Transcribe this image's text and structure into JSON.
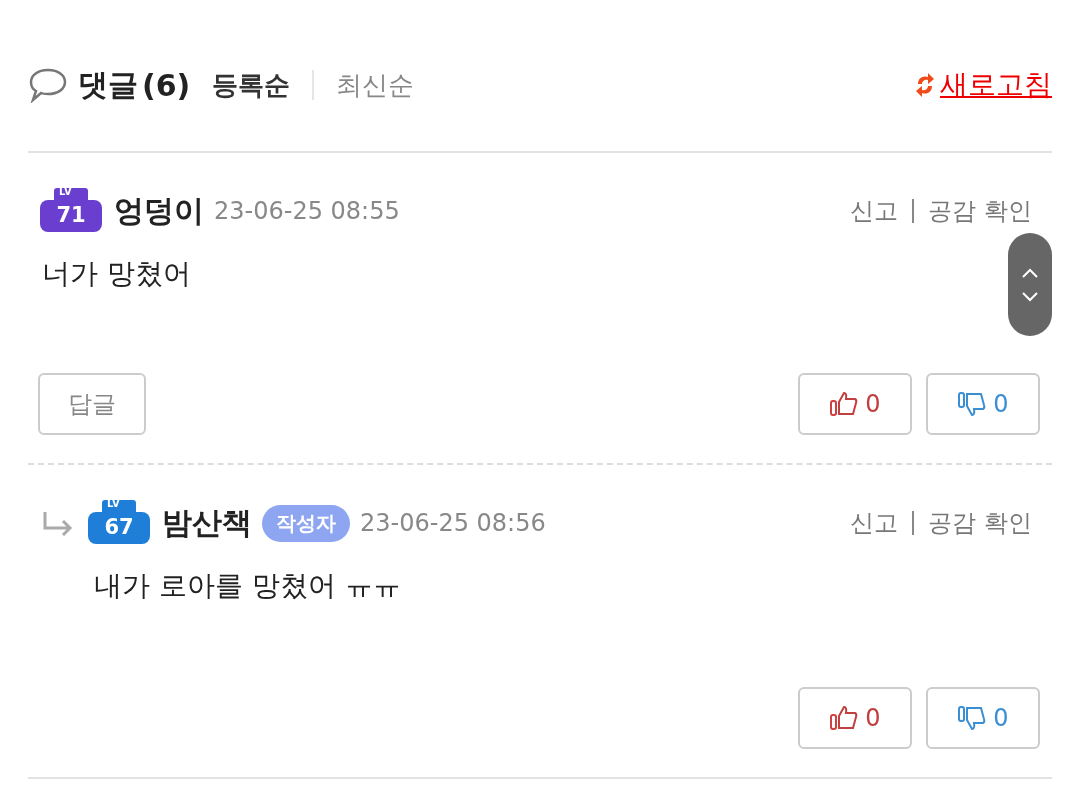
{
  "header": {
    "title": "댓글",
    "count": "(6)",
    "sort_tabs": [
      {
        "label": "등록순",
        "selected": true
      },
      {
        "label": "최신순",
        "selected": false
      }
    ],
    "refresh": "새로고침"
  },
  "comments": [
    {
      "kind": "comment",
      "level_badge": {
        "lv": "LV",
        "number": "71",
        "color": "#6a3fd0"
      },
      "author": "엉덩이",
      "date": "23-06-25 08:55",
      "report": "신고",
      "likes_link": "공감 확인",
      "body": "너가 망쳤어",
      "reply_button": "답글",
      "up": "0",
      "down": "0"
    },
    {
      "kind": "reply",
      "level_badge": {
        "lv": "LV",
        "number": "67",
        "color": "#1f7fd8"
      },
      "author": "밤산책",
      "author_tag": "작성자",
      "date": "23-06-25 08:56",
      "report": "신고",
      "likes_link": "공감 확인",
      "body": "내가 로아를 망쳤어 ㅠㅠ",
      "up": "0",
      "down": "0"
    }
  ]
}
